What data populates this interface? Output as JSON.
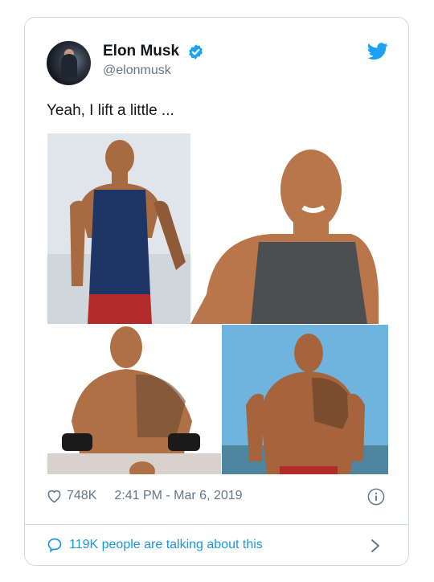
{
  "tweet": {
    "author_name": "Elon Musk",
    "author_handle": "@elonmusk",
    "text": "Yeah, I lift a little ...",
    "likes": "748K",
    "timestamp": "2:41 PM - Mar 6, 2019",
    "talking": "119K people are talking about this"
  },
  "icons": {
    "verified": "verified-badge-icon",
    "bird": "twitter-bird-icon",
    "heart": "heart-icon",
    "info": "info-icon",
    "bubble": "speech-bubble-icon",
    "chevron": "chevron-right-icon"
  },
  "colors": {
    "accent": "#1da1f2",
    "link": "#1b95e0",
    "muted": "#657786",
    "text": "#14171a",
    "border": "#cfd9de"
  }
}
